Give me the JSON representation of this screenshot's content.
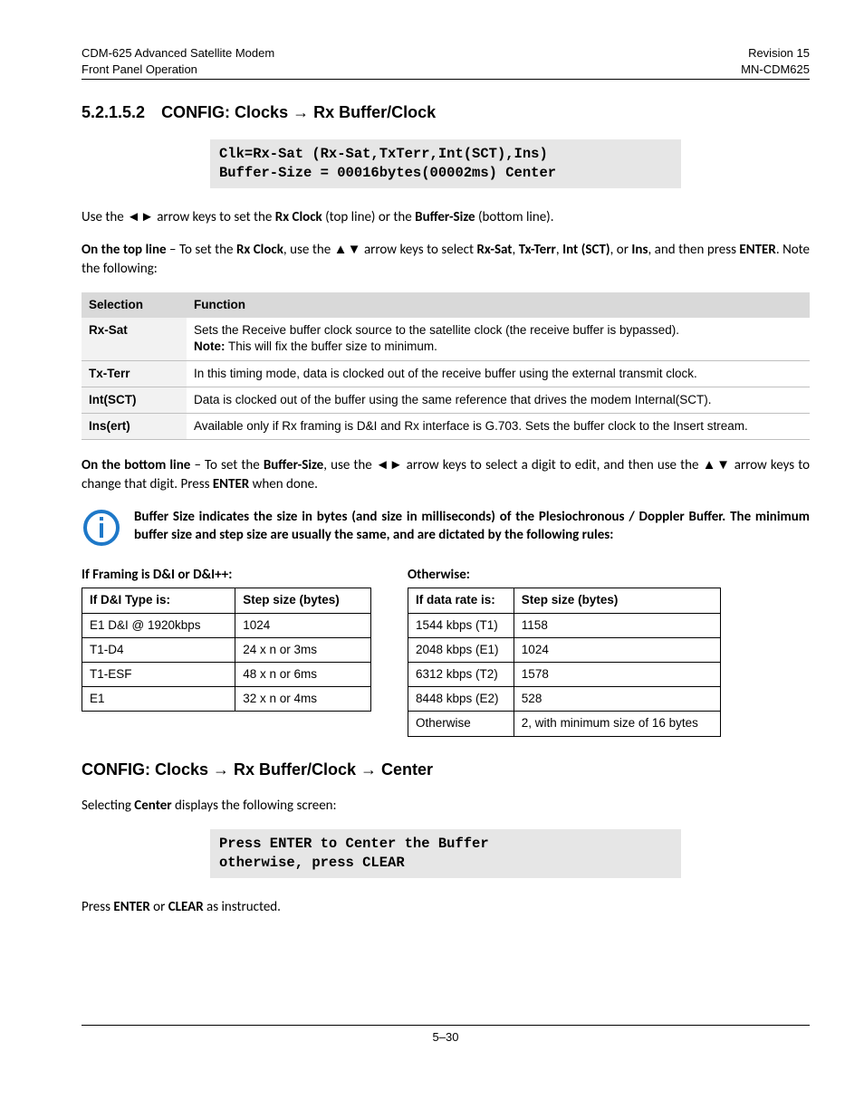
{
  "header": {
    "left1": "CDM-625 Advanced Satellite Modem",
    "left2": "Front Panel Operation",
    "right1": "Revision 15",
    "right2": "MN-CDM625"
  },
  "section1": {
    "num": "5.2.1.5.2",
    "title": "CONFIG: Clocks → Rx Buffer/Clock",
    "code1": "Clk=Rx-Sat  (Rx-Sat,TxTerr,Int(SCT),Ins)",
    "code2": "Buffer-Size = 00016bytes(00002ms) Center",
    "p1a": "Use the ◄► arrow keys to set the ",
    "p1b": "Rx Clock",
    "p1c": " (top line) or the ",
    "p1d": "Buffer-Size",
    "p1e": " (bottom line).",
    "p2a": "On the top line",
    "p2b": " – To set the ",
    "p2c": "Rx Clock",
    "p2d": ", use the ▲▼ arrow keys to select ",
    "p2e": "Rx-Sat",
    "p2f": ", ",
    "p2g": "Tx-Terr",
    "p2h": ", ",
    "p2i": "Int (SCT)",
    "p2j": ", or ",
    "p2k": "Ins",
    "p2l": ", and then press ",
    "p2m": "ENTER",
    "p2n": ". Note the following:"
  },
  "seltable": {
    "h1": "Selection",
    "h2": "Function",
    "rows": [
      {
        "sel": "Rx-Sat",
        "func": "Sets the Receive buffer clock source to the satellite clock (the receive buffer is bypassed).",
        "note": "Note:",
        "noteText": " This will fix the buffer size to minimum."
      },
      {
        "sel": "Tx-Terr",
        "func": "In this timing mode, data is clocked out of the receive buffer using the external transmit clock."
      },
      {
        "sel": "Int(SCT)",
        "func": "Data is clocked out of the buffer using the same reference that drives the modem Internal(SCT)."
      },
      {
        "sel": "Ins(ert)",
        "func": "Available only if Rx framing is D&I and Rx interface is G.703. Sets the buffer clock to the Insert stream."
      }
    ]
  },
  "p3": {
    "a": "On the bottom line",
    "b": " – To set the ",
    "c": "Buffer-Size",
    "d": ", use the ◄► arrow keys to select a digit to edit, and then use the ▲▼ arrow keys to change that digit. Press ",
    "e": "ENTER",
    "f": " when done."
  },
  "note": "Buffer Size indicates the size in bytes (and size in milliseconds) of the Plesiochronous / Doppler Buffer. The minimum buffer size and step size are usually the same, and are dictated by the following rules:",
  "leftTable": {
    "title": "If Framing is D&I or D&I++:",
    "h1": "If D&I Type is:",
    "h2": "Step size (bytes)",
    "rows": [
      {
        "a": "E1 D&I @ 1920kbps",
        "b": "1024"
      },
      {
        "a": "T1-D4",
        "b": "24 x n  or 3ms"
      },
      {
        "a": "T1-ESF",
        "b": "48 x n  or 6ms"
      },
      {
        "a": "E1",
        "b": "32 x n  or 4ms"
      }
    ]
  },
  "rightTable": {
    "title": "Otherwise:",
    "h1": "If data rate is:",
    "h2": "Step size (bytes)",
    "rows": [
      {
        "a": "1544 kbps (T1)",
        "b": "1158"
      },
      {
        "a": "2048 kbps (E1)",
        "b": "1024"
      },
      {
        "a": "6312 kbps (T2)",
        "b": "1578"
      },
      {
        "a": "8448 kbps (E2)",
        "b": "528"
      },
      {
        "a": "Otherwise",
        "b": "2, with minimum size of 16 bytes"
      }
    ]
  },
  "section2": {
    "title": "CONFIG: Clocks → Rx Buffer/Clock → Center",
    "p1a": "Selecting ",
    "p1b": "Center",
    "p1c": " displays the following screen:",
    "code1": "Press ENTER to Center the Buffer",
    "code2": "otherwise, press CLEAR",
    "p2a": "Press ",
    "p2b": "ENTER",
    "p2c": " or ",
    "p2d": "CLEAR",
    "p2e": " as instructed."
  },
  "footer": "5–30"
}
